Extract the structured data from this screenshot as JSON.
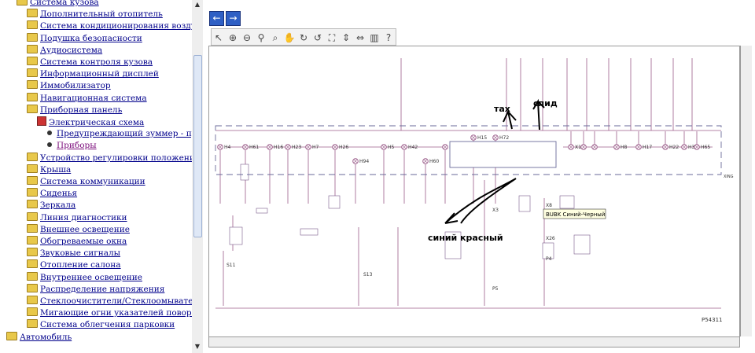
{
  "tree": {
    "items": [
      {
        "label": "Система кузова",
        "indent": 1,
        "icon": "folder-open-icon"
      },
      {
        "label": "Дополнительный отопитель",
        "indent": 2,
        "icon": "folder-icon"
      },
      {
        "label": "Система кондиционирования воздуха",
        "indent": 2,
        "icon": "folder-icon"
      },
      {
        "label": "Подушка безопасности",
        "indent": 2,
        "icon": "folder-icon"
      },
      {
        "label": "Аудиосистема",
        "indent": 2,
        "icon": "folder-icon"
      },
      {
        "label": "Система контроля кузова",
        "indent": 2,
        "icon": "folder-icon"
      },
      {
        "label": "Информационный дисплей",
        "indent": 2,
        "icon": "folder-icon"
      },
      {
        "label": "Иммобилизатор",
        "indent": 2,
        "icon": "folder-icon"
      },
      {
        "label": "Навигационная система",
        "indent": 2,
        "icon": "folder-icon"
      },
      {
        "label": "Приборная панель",
        "indent": 2,
        "icon": "folder-open-icon"
      },
      {
        "label": "Электрическая схема",
        "indent": 3,
        "icon": "book-icon"
      },
      {
        "label": "Предупреждающий зуммер - проверк",
        "indent": 4,
        "icon": "bullet-icon"
      },
      {
        "label": "Приборы",
        "indent": 4,
        "icon": "bullet-icon",
        "selected": true
      },
      {
        "label": "Устройство регулировки положения фар",
        "indent": 2,
        "icon": "folder-icon"
      },
      {
        "label": "Крыша",
        "indent": 2,
        "icon": "folder-icon"
      },
      {
        "label": "Система коммуникации",
        "indent": 2,
        "icon": "folder-icon"
      },
      {
        "label": "Сиденья",
        "indent": 2,
        "icon": "folder-icon"
      },
      {
        "label": "Зеркала",
        "indent": 2,
        "icon": "folder-icon"
      },
      {
        "label": "Линия диагностики",
        "indent": 2,
        "icon": "folder-icon"
      },
      {
        "label": "Внешнее освещение",
        "indent": 2,
        "icon": "folder-icon"
      },
      {
        "label": "Обогреваемые окна",
        "indent": 2,
        "icon": "folder-icon"
      },
      {
        "label": "Звуковые сигналы",
        "indent": 2,
        "icon": "folder-icon"
      },
      {
        "label": "Отопление салона",
        "indent": 2,
        "icon": "folder-icon"
      },
      {
        "label": "Внутреннее освещение",
        "indent": 2,
        "icon": "folder-icon"
      },
      {
        "label": "Распределение напряжения",
        "indent": 2,
        "icon": "folder-icon"
      },
      {
        "label": "Стеклоочистители/Стеклоомыватели",
        "indent": 2,
        "icon": "folder-icon"
      },
      {
        "label": "Мигающие огни указателей поворота и пр",
        "indent": 2,
        "icon": "folder-icon"
      },
      {
        "label": "Система облегчения парковки",
        "indent": 2,
        "icon": "folder-icon"
      },
      {
        "label": "Автомобиль",
        "indent": 0,
        "icon": "folder-icon"
      }
    ]
  },
  "nav": {
    "back_icon": "arrow-left-icon",
    "forward_icon": "arrow-right-icon"
  },
  "toolbar": {
    "tools": [
      "select-arrow-icon",
      "zoom-in-icon",
      "zoom-out-icon",
      "zoom-icon",
      "zoom-window-icon",
      "pan-hand-icon",
      "rotate-right-icon",
      "rotate-left-icon",
      "fit-page-icon",
      "fit-height-icon",
      "fit-width-icon",
      "highlight-icon",
      "help-icon"
    ]
  },
  "diagram": {
    "annotations": {
      "tach": "тах",
      "speed": "спид",
      "wires": "синий красный"
    },
    "tooltip": "BUBK Синий-Черный",
    "components": [
      "H4",
      "H61",
      "H16",
      "H23",
      "H7",
      "H26",
      "H94",
      "H5",
      "H42",
      "H60",
      "H30",
      "H15",
      "H72",
      "P1",
      "P2",
      "P7",
      "P43",
      "X11",
      "H8",
      "H17",
      "H22",
      "H3",
      "H65",
      "X3",
      "X8",
      "X26",
      "P4",
      "P5",
      "X2",
      "S14",
      "S11",
      "S13"
    ],
    "block_label": "XING",
    "figure_id": "P54311"
  },
  "colors": {
    "wire": "#9b5c8a",
    "frame": "#6a6a9a",
    "ink": "#000000",
    "nav": "#2e5fc4"
  }
}
